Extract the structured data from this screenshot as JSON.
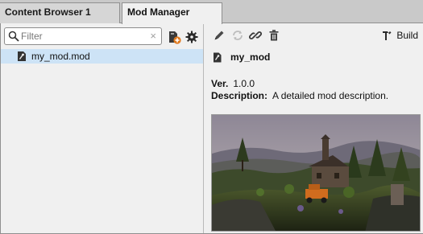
{
  "tabs": [
    {
      "label": "Content Browser 1",
      "active": false
    },
    {
      "label": "Mod Manager",
      "active": true
    }
  ],
  "filter": {
    "placeholder": "Filter",
    "value": "",
    "clear_icon": "×"
  },
  "toolbar_left": {
    "icons": [
      "add-mod-icon",
      "settings-icon"
    ]
  },
  "mod_list": [
    {
      "name": "my_mod.mod",
      "icon": "mod-file-icon",
      "selected": true
    }
  ],
  "toolbar_right": {
    "icons": [
      "pencil-icon",
      "refresh-icon",
      "link-icon",
      "trash-icon"
    ],
    "build_label": "Build"
  },
  "details": {
    "title": "my_mod",
    "version_label": "Ver.",
    "version": "1.0.0",
    "description_label": "Description:",
    "description": "A detailed mod description."
  },
  "colors": {
    "selection": "#cde3f6",
    "accent_orange": "#e07a1f",
    "panel_bg": "#f0f0f0"
  }
}
